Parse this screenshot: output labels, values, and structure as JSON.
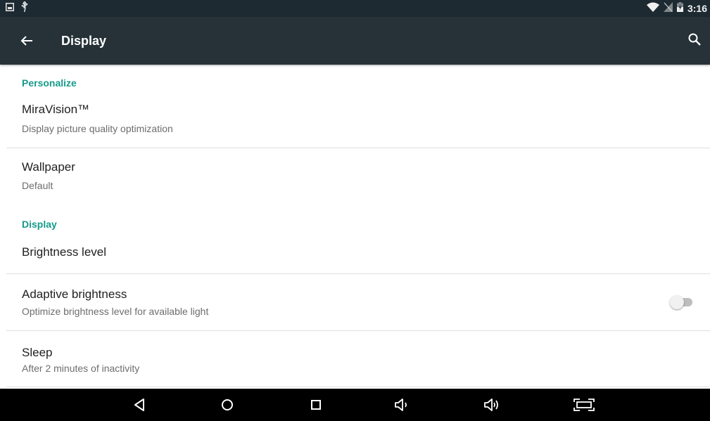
{
  "status_bar": {
    "time": "3:16",
    "left_icons": [
      "gallery-notification-icon",
      "usb-icon"
    ],
    "right_icons": [
      "wifi-icon",
      "no-sim-icon",
      "battery-charging-icon"
    ]
  },
  "toolbar": {
    "title": "Display",
    "background": "#263238",
    "icons": [
      "back-arrow-icon",
      "search-icon"
    ]
  },
  "accent_color": "#159a8a",
  "sections": [
    {
      "category": "Personalize",
      "items": [
        {
          "title": "MiraVision™",
          "summary": "Display picture quality optimization"
        },
        {
          "title": "Wallpaper",
          "summary": "Default"
        }
      ]
    },
    {
      "category": "Display",
      "items": [
        {
          "title": "Brightness level",
          "summary": ""
        },
        {
          "title": "Adaptive brightness",
          "summary": "Optimize brightness level for available light",
          "toggle": "off"
        },
        {
          "title": "Sleep",
          "summary": "After 2 minutes of inactivity"
        }
      ]
    }
  ],
  "nav_bar": {
    "buttons": [
      "back-triangle-icon",
      "home-circle-icon",
      "recents-square-icon",
      "volume-down-icon",
      "volume-up-icon",
      "screenshot-icon"
    ]
  }
}
